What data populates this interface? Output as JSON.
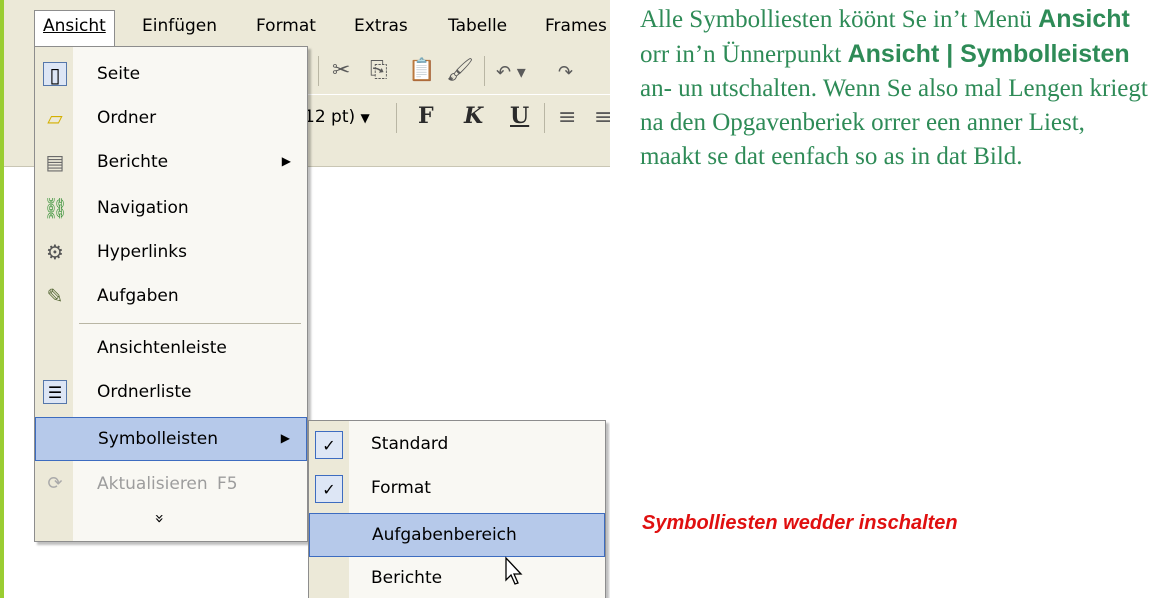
{
  "menubar": {
    "items": [
      {
        "label": "Ansicht",
        "active": true
      },
      {
        "label": "Einfügen"
      },
      {
        "label": "Format"
      },
      {
        "label": "Extras"
      },
      {
        "label": "Tabelle"
      },
      {
        "label": "Frames"
      }
    ]
  },
  "toolbar": {
    "font_size_value": "12 pt)",
    "bold_label": "F",
    "italic_label": "K",
    "underline_label": "U"
  },
  "menu": {
    "items": [
      {
        "label": "Seite",
        "icon": "page-icon"
      },
      {
        "label": "Ordner",
        "icon": "folder-icon"
      },
      {
        "label": "Berichte",
        "icon": "reports-icon",
        "submenu": true
      },
      {
        "label": "Navigation",
        "icon": "navigation-icon"
      },
      {
        "label": "Hyperlinks",
        "icon": "hyperlinks-icon"
      },
      {
        "label": "Aufgaben",
        "icon": "tasks-icon"
      },
      {
        "label": "Ansichtenleiste"
      },
      {
        "label": "Ordnerliste",
        "icon": "folder-list-icon"
      },
      {
        "label": "Symbolleisten",
        "submenu": true,
        "selected": true
      },
      {
        "label": "Aktualisieren",
        "icon": "refresh-icon",
        "shortcut": "F5",
        "disabled": true
      }
    ],
    "expand_glyph": "»"
  },
  "submenu": {
    "items": [
      {
        "label": "Standard",
        "checked": true
      },
      {
        "label": "Format",
        "checked": true
      },
      {
        "label": "Aufgabenbereich",
        "selected": true
      },
      {
        "label": "Berichte"
      }
    ],
    "check_glyph": "✓"
  },
  "article": {
    "t1": "Alle Symbolliesten köönt Se in’t Me­nü ",
    "b1": "Ansicht",
    "t2": " orr in’n Ünnerpunkt ",
    "b2": "Ansicht | Symbolleisten",
    "t3": " an- un utschal­ten. Wenn Se also mal Lengen kriegt na den Opgavenberiek orrer een anner Liest, maakt se dat eenfach so as in dat Bild."
  },
  "caption": "Symbolliesten wedder inschalten",
  "colors": {
    "text_green": "#2e8b57",
    "caption_red": "#e01010",
    "selection_blue": "#b6c9ea",
    "border_green": "#9acd32"
  }
}
